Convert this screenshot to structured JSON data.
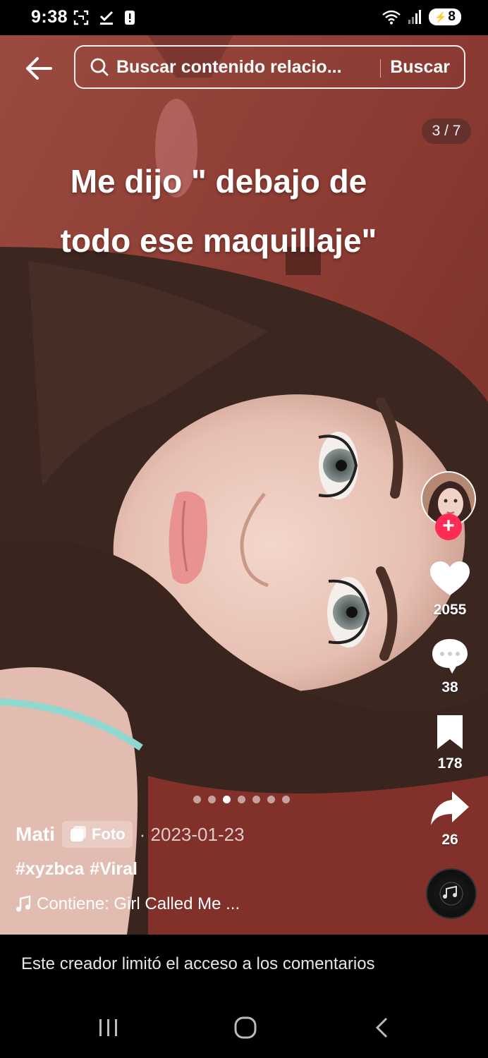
{
  "status_bar": {
    "time": "9:38",
    "battery_level": "8",
    "icons": [
      "screenshot-icon",
      "download-done-icon",
      "alert-icon",
      "wifi-icon",
      "signal-icon",
      "battery-icon"
    ]
  },
  "top_bar": {
    "search_placeholder": "Buscar contenido relacio...",
    "search_button": "Buscar"
  },
  "photo": {
    "page_counter": "3 / 7",
    "overlay_text_line1": "Me dijo \" debajo de",
    "overlay_text_line2": "todo ese maquillaje\"",
    "carousel_total": 7,
    "carousel_active_index": 3
  },
  "side_rail": {
    "likes": "2055",
    "comments": "38",
    "saves": "178",
    "shares": "26"
  },
  "post": {
    "author": "Mati",
    "badge_label": "Foto",
    "date": "· 2023-01-23",
    "hashtags": [
      "#xyzbca",
      "#Viral"
    ],
    "music": "Contiene: Girl Called Me ..."
  },
  "comments_notice": "Este creador limitó el acceso a los comentarios",
  "colors": {
    "accent": "#fe2c55",
    "background": "#000000",
    "wall": "#8a3a30"
  }
}
